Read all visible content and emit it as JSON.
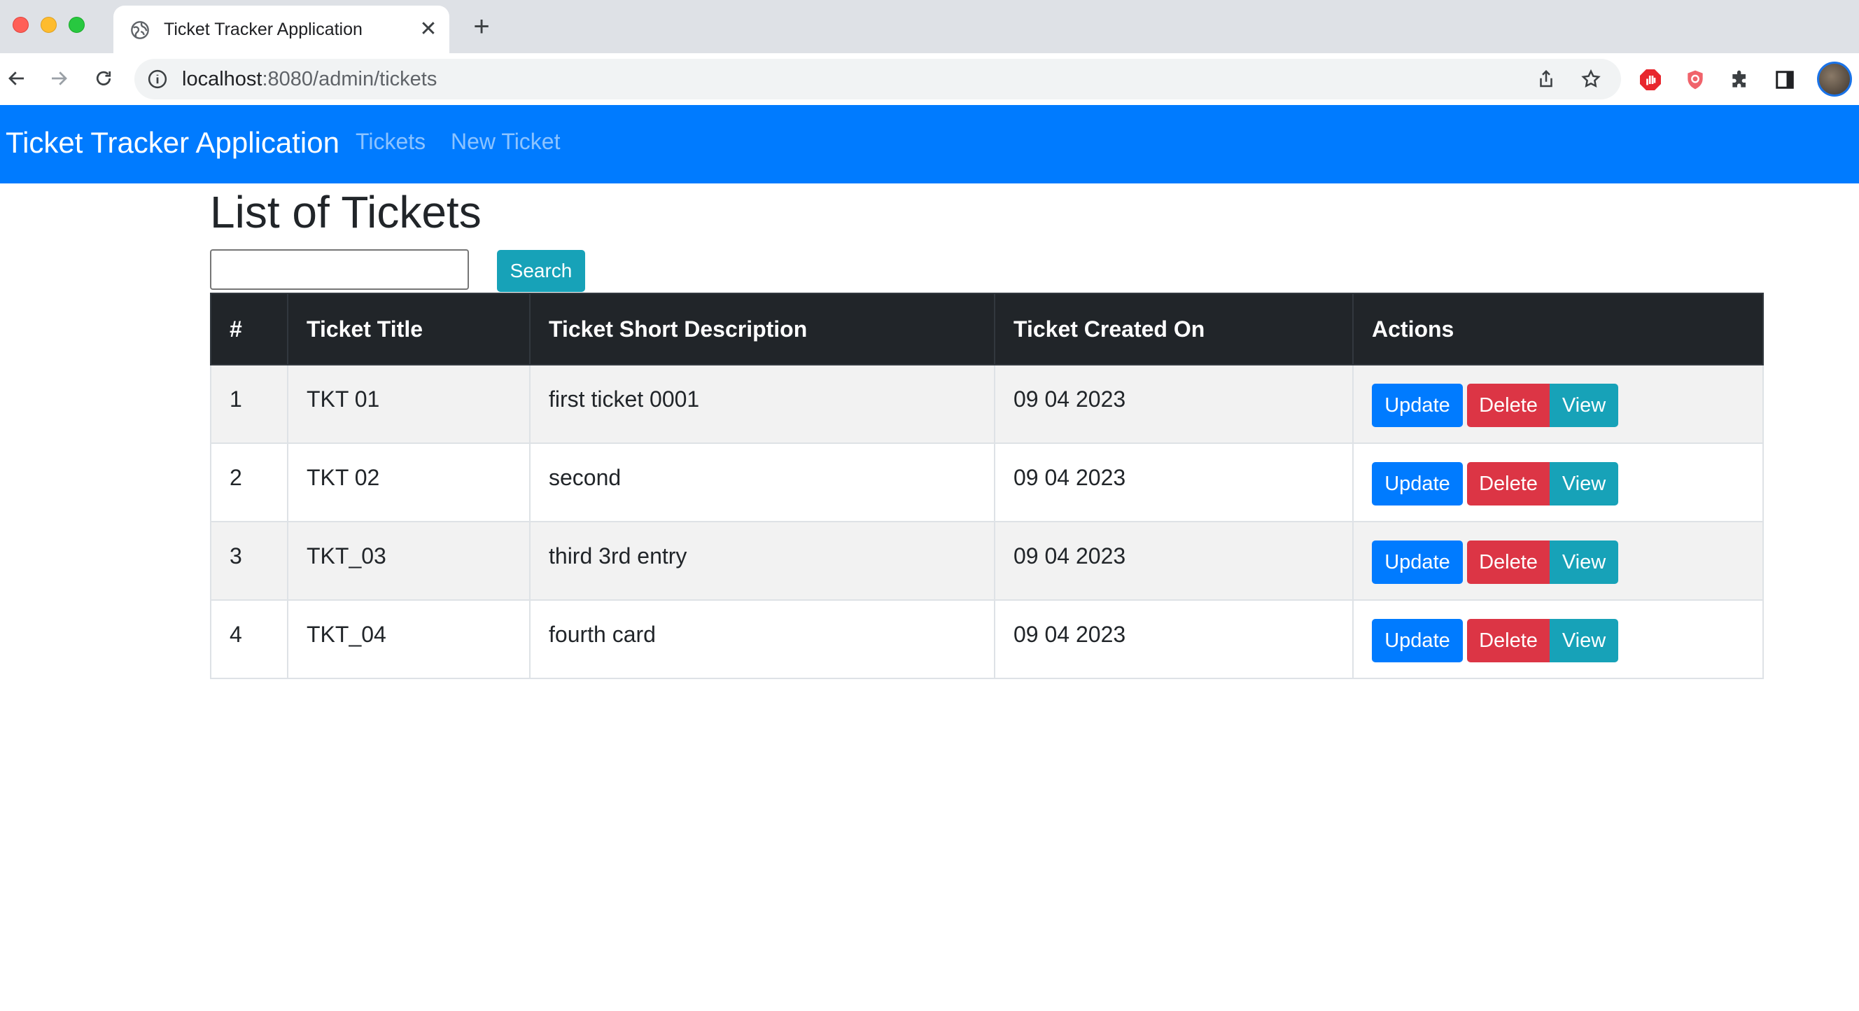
{
  "browser": {
    "tab_title": "Ticket Tracker Application",
    "tab_close": "✕",
    "new_tab": "+",
    "url_host": "localhost",
    "url_path": ":8080/admin/tickets"
  },
  "navbar": {
    "brand": "Ticket Tracker Application",
    "links": [
      {
        "label": "Tickets"
      },
      {
        "label": "New Ticket"
      }
    ],
    "color": "#007bff"
  },
  "main": {
    "title": "List of Tickets",
    "search": {
      "value": "",
      "button_label": "Search"
    },
    "table": {
      "headers": [
        "#",
        "Ticket Title",
        "Ticket Short Description",
        "Ticket Created On",
        "Actions"
      ],
      "rows": [
        {
          "id": "1",
          "title": "TKT 01",
          "description": "first ticket 0001",
          "created": "09 04 2023"
        },
        {
          "id": "2",
          "title": "TKT 02",
          "description": "second",
          "created": "09 04 2023"
        },
        {
          "id": "3",
          "title": "TKT_03",
          "description": "third 3rd entry",
          "created": "09 04 2023"
        },
        {
          "id": "4",
          "title": "TKT_04",
          "description": "fourth card",
          "created": "09 04 2023"
        }
      ],
      "actions": {
        "update": "Update",
        "delete": "Delete",
        "view": "View"
      }
    }
  },
  "colors": {
    "update": "#007bff",
    "delete": "#dc3545",
    "view": "#17a2b8",
    "header": "#212529"
  }
}
